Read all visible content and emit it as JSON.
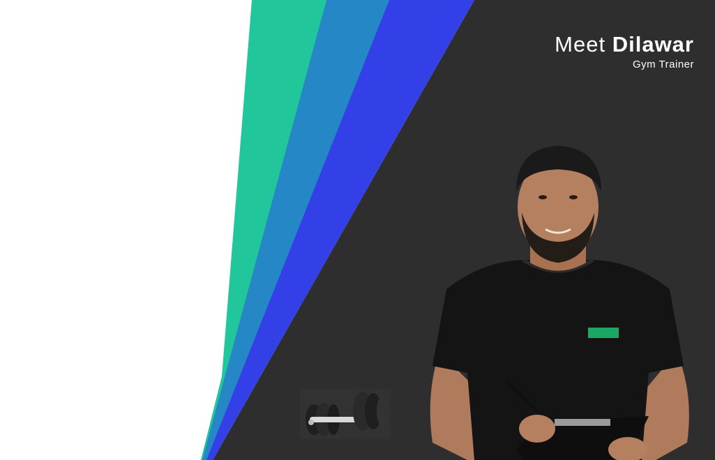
{
  "header": {
    "meet": "Meet",
    "name": "Dilawar",
    "role": "Gym Trainer"
  },
  "colors": {
    "dark_panel": "#2e2e2e",
    "stripe_green": "#21c79a",
    "stripe_blue": "#2587c6",
    "stripe_indigo": "#3340e8",
    "badge_green": "#1aa864"
  },
  "images": {
    "trainer": "trainer-photo",
    "equipment": "dumbbell-icon"
  }
}
